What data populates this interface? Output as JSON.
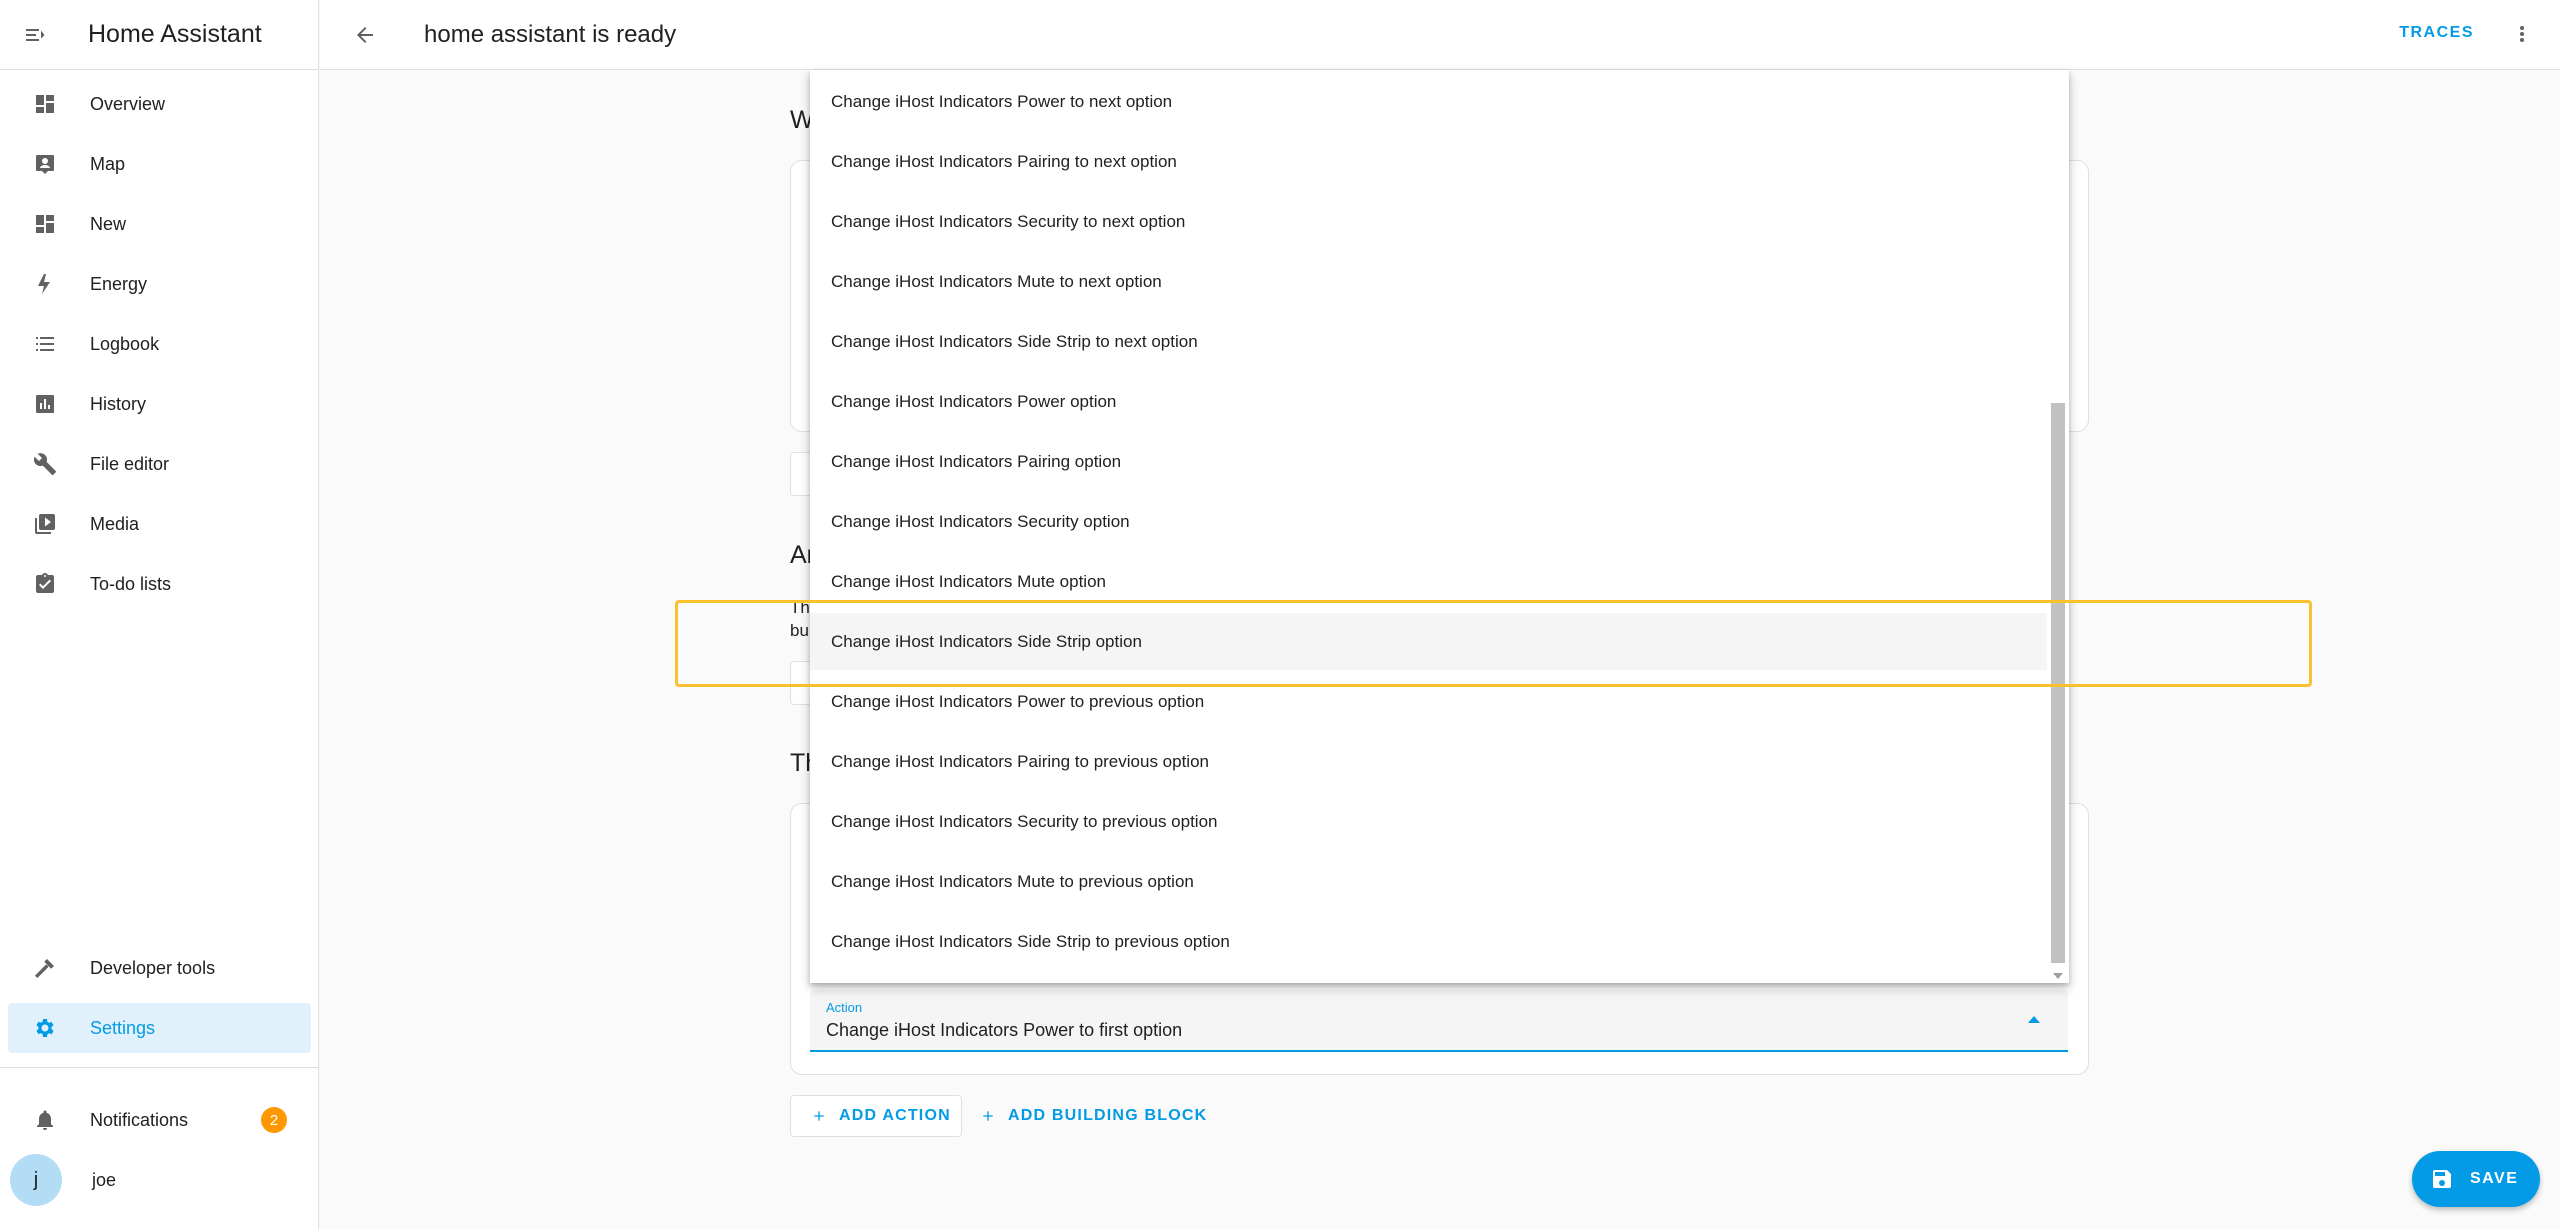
{
  "app": {
    "title": "Home Assistant"
  },
  "sidebar": {
    "items": [
      {
        "label": "Overview",
        "icon": "dashboard-icon"
      },
      {
        "label": "Map",
        "icon": "map-icon"
      },
      {
        "label": "New",
        "icon": "dashboard-icon"
      },
      {
        "label": "Energy",
        "icon": "lightning-icon"
      },
      {
        "label": "Logbook",
        "icon": "list-icon"
      },
      {
        "label": "History",
        "icon": "chart-icon"
      },
      {
        "label": "File editor",
        "icon": "wrench-icon"
      },
      {
        "label": "Media",
        "icon": "media-icon"
      },
      {
        "label": "To-do lists",
        "icon": "clipboard-icon"
      }
    ],
    "developer_tools": "Developer tools",
    "settings": "Settings",
    "notifications": {
      "label": "Notifications",
      "count": "2"
    },
    "user": {
      "name": "joe",
      "initial": "j"
    }
  },
  "header": {
    "title": "home assistant is ready",
    "traces": "TRACES"
  },
  "background_fragments": {
    "when_head": "W",
    "and_head": "Ar",
    "and_desc_1": "Th",
    "and_desc_2": "bu",
    "then_head": "Th"
  },
  "action_field": {
    "label": "Action",
    "value": "Change iHost Indicators Power to first option"
  },
  "buttons": {
    "add_action": "ADD ACTION",
    "add_building_block": "ADD BUILDING BLOCK",
    "save": "SAVE"
  },
  "dropdown": {
    "items": [
      "Change iHost Indicators Power to next option",
      "Change iHost Indicators Pairing to next option",
      "Change iHost Indicators Security to next option",
      "Change iHost Indicators Mute to next option",
      "Change iHost Indicators Side Strip to next option",
      "Change iHost Indicators Power option",
      "Change iHost Indicators Pairing option",
      "Change iHost Indicators Security option",
      "Change iHost Indicators Mute option",
      "Change iHost Indicators Side Strip option",
      "Change iHost Indicators Power to previous option",
      "Change iHost Indicators Pairing to previous option",
      "Change iHost Indicators Security to previous option",
      "Change iHost Indicators Mute to previous option",
      "Change iHost Indicators Side Strip to previous option"
    ],
    "highlighted_item": "Change iHost Indicators Side Strip option"
  },
  "colors": {
    "accent": "#039be5",
    "badge": "#ff9800",
    "highlight_outline": "#fbc02d"
  }
}
